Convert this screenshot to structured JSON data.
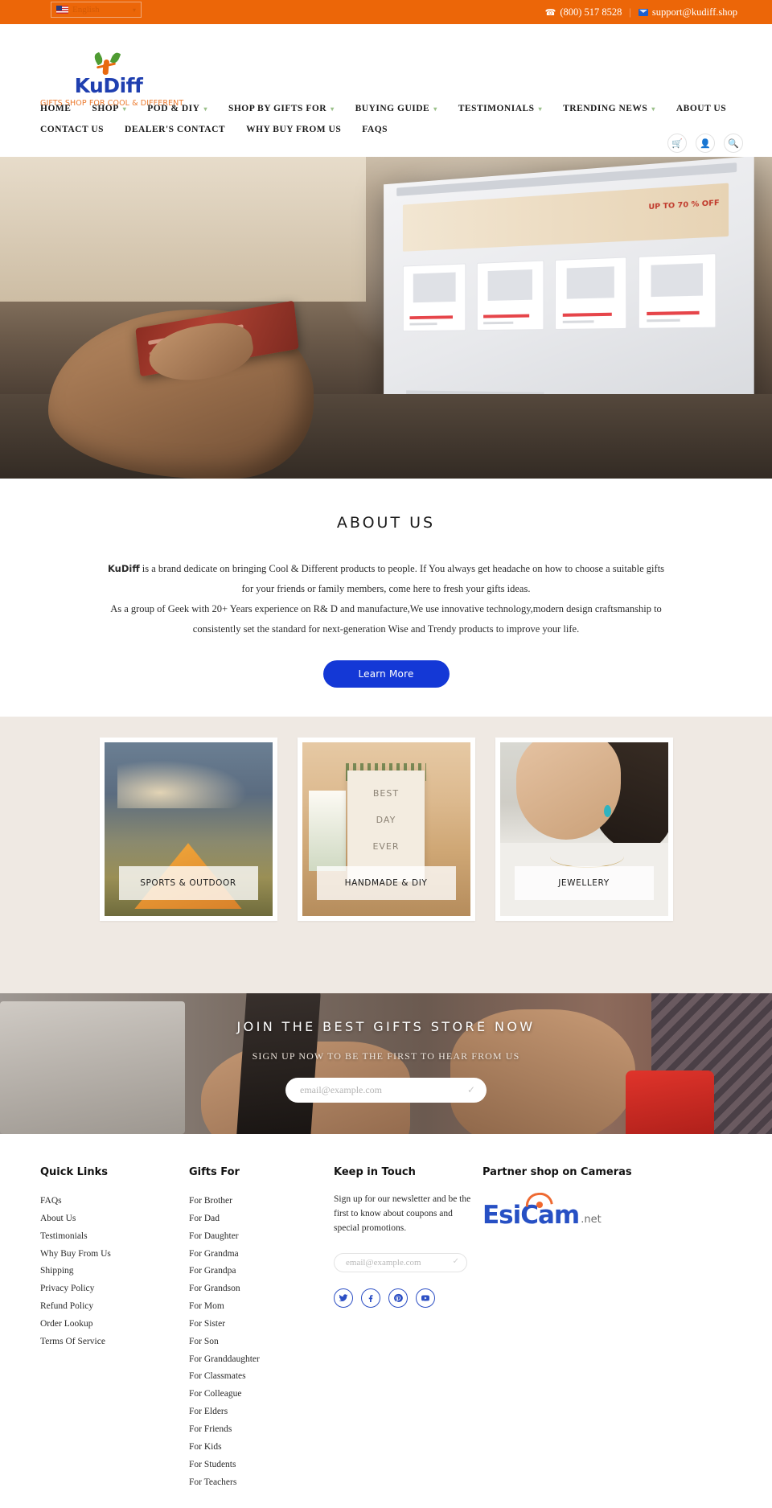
{
  "topbar": {
    "language": "English",
    "language_flag": "us-flag-icon",
    "phone": "(800) 517 8528",
    "email": "support@kudiff.shop",
    "separator": "|"
  },
  "logo": {
    "name": "KuDiff",
    "tagline": "GIFTS SHOP FOR COOL & DIFFERENT"
  },
  "nav": {
    "row1": [
      {
        "label": "HOME",
        "caret": false
      },
      {
        "label": "SHOP",
        "caret": true
      },
      {
        "label": "POD & DIY",
        "caret": true
      },
      {
        "label": "SHOP BY GIFTS FOR",
        "caret": true
      },
      {
        "label": "BUYING GUIDE",
        "caret": true
      },
      {
        "label": "TESTIMONIALS",
        "caret": true
      },
      {
        "label": "TRENDING NEWS",
        "caret": true
      },
      {
        "label": "ABOUT US",
        "caret": false
      }
    ],
    "row2": [
      {
        "label": "CONTACT US",
        "caret": false
      },
      {
        "label": "DEALER'S CONTACT",
        "caret": false
      },
      {
        "label": "WHY BUY FROM US",
        "caret": false
      },
      {
        "label": "FAQS",
        "caret": false
      }
    ],
    "icons": [
      {
        "name": "cart-icon",
        "glyph": "🛒"
      },
      {
        "name": "account-icon",
        "glyph": "👤"
      },
      {
        "name": "search-icon",
        "glyph": "🔍"
      }
    ]
  },
  "about": {
    "title": "ABOUT US",
    "brand": "KuDiff",
    "paragraph1": " is a brand dedicate on bringing Cool & Different products to people. If You always get headache on how to choose a suitable gifts for your friends or family members, come here to fresh your gifts ideas.",
    "paragraph2": "As a group of Geek with 20+ Years experience on R& D and manufacture,We use innovative technology,modern design craftsmanship to consistently set the standard for next-generation Wise and Trendy products to improve your life.",
    "button": "Learn More"
  },
  "categories": [
    {
      "label": "SPORTS & OUTDOOR"
    },
    {
      "label": "HANDMADE & DIY"
    },
    {
      "label": "JEWELLERY"
    }
  ],
  "join": {
    "title": "JOIN THE BEST GIFTS STORE NOW",
    "subtitle": "SIGN UP NOW TO BE THE FIRST TO HEAR FROM US",
    "placeholder": "email@example.com",
    "value": "",
    "submit_icon": "check-icon"
  },
  "footer": {
    "quick_links": {
      "title": "Quick Links",
      "items": [
        "FAQs",
        "About Us",
        "Testimonials",
        "Why Buy From Us",
        "Shipping",
        "Privacy Policy",
        "Refund Policy",
        "Order Lookup",
        "Terms Of Service"
      ]
    },
    "gifts_for": {
      "title": "Gifts For",
      "items": [
        "For Brother",
        "For Dad",
        "For Daughter",
        "For Grandma",
        "For Grandpa",
        "For Grandson",
        "For Mom",
        "For Sister",
        "For Son",
        "For Granddaughter",
        "For Classmates",
        "For Colleague",
        "For Elders",
        "For Friends",
        "For Kids",
        "For Students",
        "For Teachers"
      ]
    },
    "keep_in_touch": {
      "title": "Keep in Touch",
      "text": "Sign up for our newsletter and be the first to know about coupons and special promotions.",
      "placeholder": "email@example.com",
      "value": "",
      "socials": [
        {
          "name": "twitter-icon",
          "glyph": "ᵗ"
        },
        {
          "name": "facebook-icon",
          "glyph": "f"
        },
        {
          "name": "pinterest-icon",
          "glyph": "P"
        },
        {
          "name": "youtube-icon",
          "glyph": "▶"
        }
      ]
    },
    "partner": {
      "title": "Partner shop on Cameras",
      "logo_word": "EsiCam",
      "logo_suffix": ".net"
    }
  },
  "colors": {
    "brand_orange": "#ec6608",
    "brand_blue": "#1f3fb0",
    "button_blue": "#1438d6",
    "cat_bg": "#efe9e3"
  }
}
